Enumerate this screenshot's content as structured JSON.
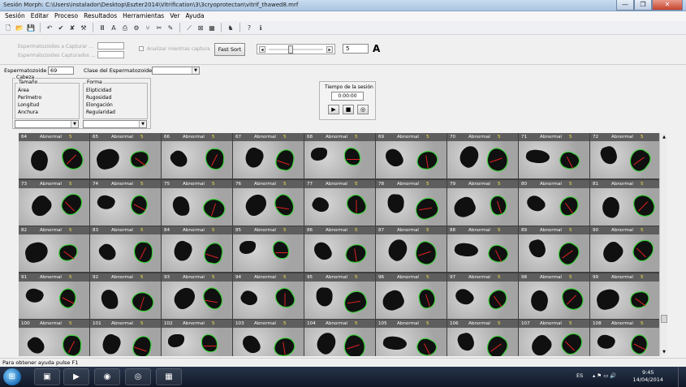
{
  "window": {
    "title": "Sesión Morph: C:\\Users\\instalador\\Desktop\\Eszter2014\\Vitrification\\3\\3cryoprotectan\\vitrif_thawed8.mrf",
    "minimize_glyph": "—",
    "maximize_glyph": "❐",
    "close_glyph": "✕"
  },
  "menu": [
    "Sesión",
    "Editar",
    "Proceso",
    "Resultados",
    "Herramientas",
    "Ver",
    "Ayuda"
  ],
  "toolbar": {
    "icons": [
      {
        "name": "new-icon",
        "glyph": "🗋"
      },
      {
        "name": "open-icon",
        "glyph": "📂"
      },
      {
        "name": "save-icon",
        "glyph": "💾"
      },
      {
        "name": "undo-icon",
        "glyph": "↶"
      },
      {
        "name": "check-icon",
        "glyph": "✔"
      },
      {
        "name": "cross-icon",
        "glyph": "✘"
      },
      {
        "name": "settings-icon",
        "glyph": "⚒"
      },
      {
        "name": "column-icon",
        "glyph": "Ⅲ"
      },
      {
        "name": "font-icon",
        "glyph": "A"
      },
      {
        "name": "print-icon",
        "glyph": "⎙"
      },
      {
        "name": "tools-icon",
        "glyph": "⚙"
      },
      {
        "name": "tweezers-icon",
        "glyph": "⑂"
      },
      {
        "name": "select-icon",
        "glyph": "✂"
      },
      {
        "name": "brush-icon",
        "glyph": "✎"
      },
      {
        "name": "line-icon",
        "glyph": "⟋"
      },
      {
        "name": "grid-cross-icon",
        "glyph": "⊠"
      },
      {
        "name": "calculator-icon",
        "glyph": "▦"
      },
      {
        "name": "figure-icon",
        "glyph": "♞"
      },
      {
        "name": "help-icon",
        "glyph": "?"
      },
      {
        "name": "info-icon",
        "glyph": "ℹ"
      }
    ]
  },
  "capture": {
    "label_capture": "Espermatozoides a Capturar ...",
    "label_captured": "Espermatozoides Capturados ...",
    "analyze_label": "Analizar mientras captura",
    "fast_sort": "Fast Sort",
    "slider_left": "◂",
    "slider_right": "▸",
    "slider_value": 0.38,
    "size_value": "5",
    "font_glyph": "A"
  },
  "selection": {
    "sperm_label": "Espermatozoide",
    "sperm_value": "69",
    "class_label": "Clase del Espermatozoide",
    "dropdown_glyph": "▼"
  },
  "cabeza": {
    "title": "Cabeza",
    "size_title": "Tamaño",
    "size_items": [
      "Área",
      "Perímetro",
      "Longitud",
      "Anchura"
    ],
    "form_title": "Forma",
    "form_items": [
      "Elipticidad",
      "Rugosidad",
      "Elongación",
      "Regularidad"
    ]
  },
  "timer": {
    "title": "Tiempo de la sesión",
    "value": "0:00:00",
    "play": "▶",
    "stop": "■",
    "record": "◎"
  },
  "cells": {
    "class": "Abnormal",
    "score": "5",
    "numbers": [
      64,
      65,
      66,
      67,
      68,
      69,
      70,
      71,
      72,
      73,
      74,
      75,
      76,
      77,
      78,
      79,
      80,
      81,
      82,
      83,
      84,
      85,
      86,
      87,
      88,
      89,
      90,
      91,
      92,
      93,
      94,
      95,
      96,
      97,
      98,
      99,
      100,
      101,
      102,
      103,
      104,
      105,
      106,
      107,
      108
    ]
  },
  "scrollbar": {
    "up": "▲",
    "down": "▼"
  },
  "status": "Para obtener ayuda pulse F1",
  "taskbar": {
    "start_glyph": "⊞",
    "apps": [
      {
        "name": "explorer-icon",
        "glyph": "▣"
      },
      {
        "name": "media-player-icon",
        "glyph": "▶"
      },
      {
        "name": "firefox-icon",
        "glyph": "◉"
      },
      {
        "name": "morph-app-icon",
        "glyph": "◎"
      },
      {
        "name": "grid-app-icon",
        "glyph": "▦"
      }
    ],
    "language": "ES",
    "tray_icons": "▴ ⚑ ▭ 🔊",
    "time": "9:45",
    "date": "14/04/2014"
  }
}
